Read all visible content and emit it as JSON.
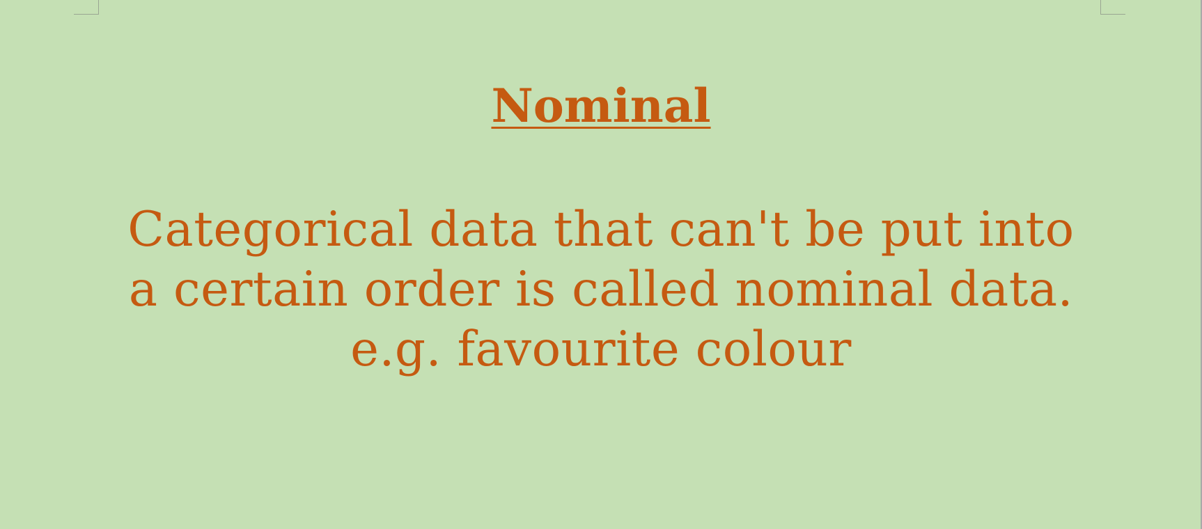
{
  "colors": {
    "page_background": "#c5e0b4",
    "text": "#c55a11"
  },
  "document": {
    "title": "Nominal",
    "lines": [
      "Categorical data that can't be put into",
      "a certain order is called nominal data.",
      "e.g. favourite colour"
    ]
  }
}
